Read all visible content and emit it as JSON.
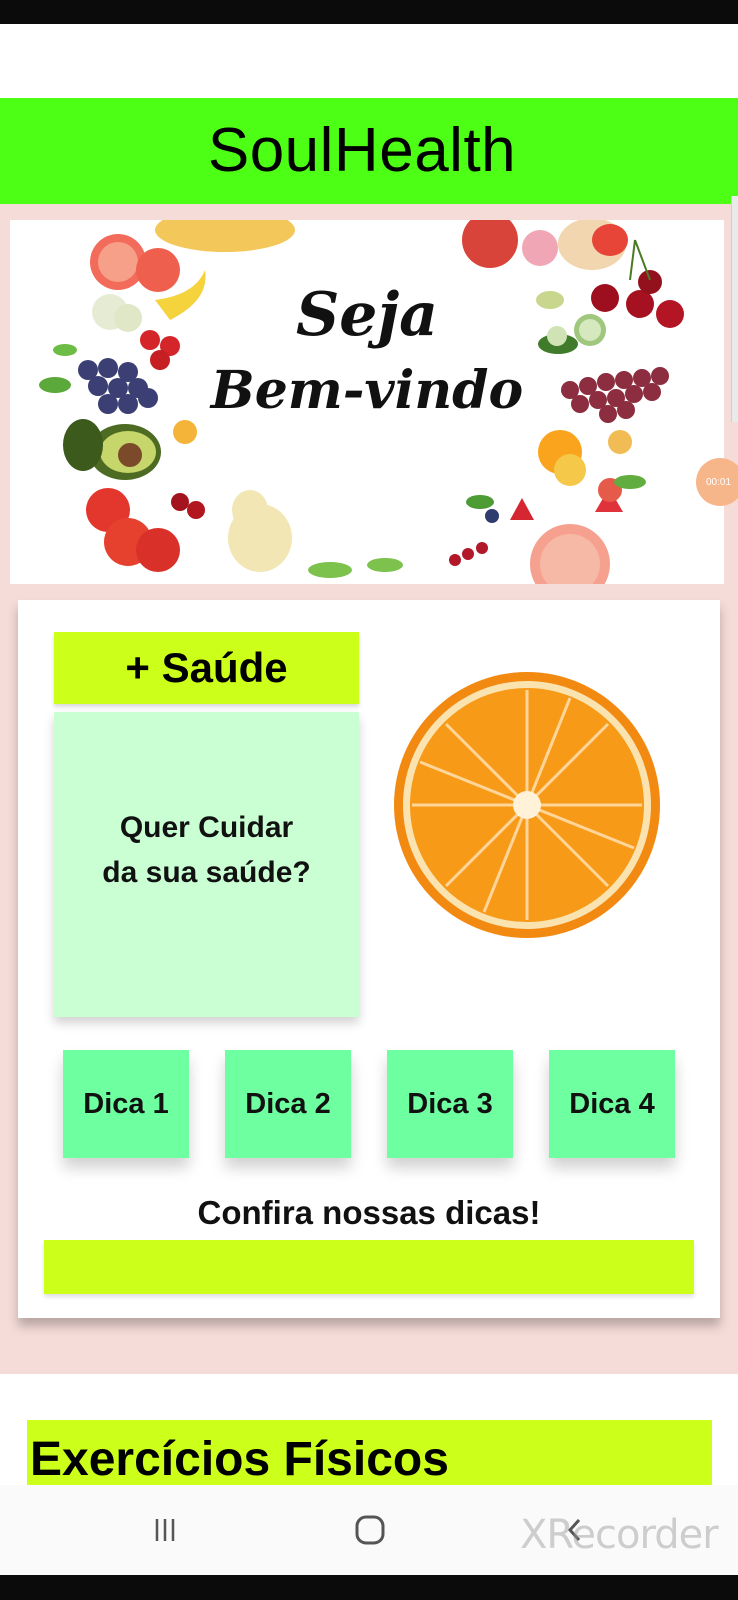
{
  "app": {
    "title": "SoulHealth"
  },
  "welcome": {
    "line1": "Seja",
    "line2": "Bem-vindo"
  },
  "saude_card": {
    "title": "+ Saúde",
    "question_line1": "Quer Cuidar",
    "question_line2": "da sua saúde?",
    "tips": [
      "Dica 1",
      "Dica 2",
      "Dica 3",
      "Dica 4"
    ],
    "cta_text": "Confira nossas dicas!"
  },
  "exercicios": {
    "title": "Exercícios Físicos"
  },
  "overlay": {
    "timer": "00:01",
    "watermark": "XRecorder"
  },
  "colors": {
    "header_green": "#4dff14",
    "lime": "#ccff19",
    "mint_button": "#6effa0",
    "question_bg": "#c9ffd3",
    "section_pink": "#f6dcd8"
  },
  "icons": {
    "nav_recent": "recent-apps-icon",
    "nav_home": "home-icon",
    "nav_back": "back-icon"
  }
}
